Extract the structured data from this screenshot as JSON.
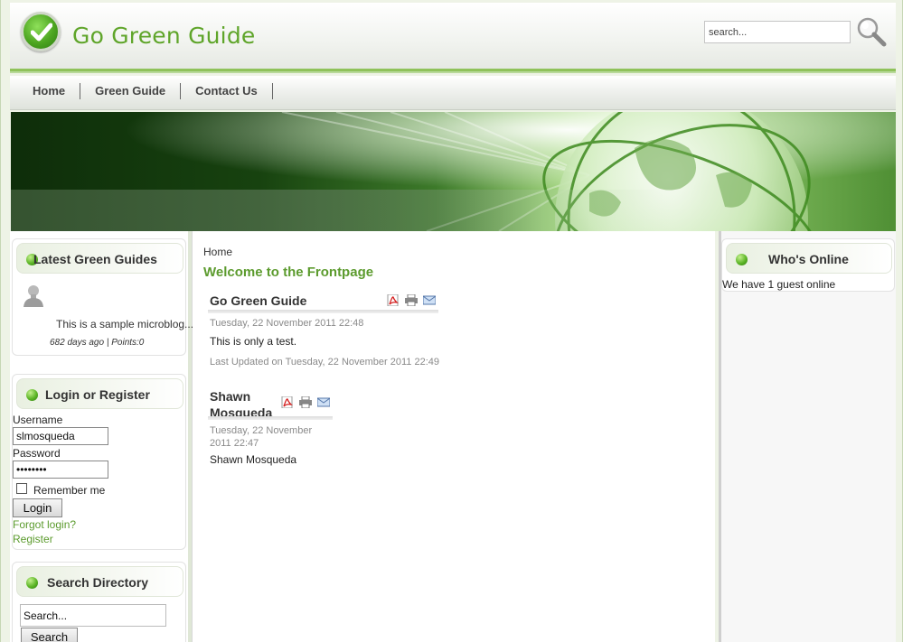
{
  "site": {
    "title": "Go Green Guide",
    "search_value": "search...",
    "accent": "#5fa52a"
  },
  "nav": {
    "items": [
      "Home",
      "Green Guide",
      "Contact Us"
    ]
  },
  "left": {
    "latest": {
      "title": "Latest Green Guides",
      "entry_text": "This is a sample microblog...",
      "meta_age": "682 days ago",
      "meta_points": "Points:0"
    },
    "login": {
      "title": "Login or Register",
      "username_label": "Username",
      "username_value": "slmosqueda",
      "password_label": "Password",
      "password_value": "********",
      "remember_label": "Remember me",
      "login_button": "Login",
      "forgot_link": "Forgot login?",
      "register_link": "Register"
    },
    "search_dir": {
      "title": "Search Directory",
      "input_value": "Search...",
      "button": "Search"
    }
  },
  "center": {
    "breadcrumb": "Home",
    "heading": "Welcome to the Frontpage",
    "articles": [
      {
        "title": "Go Green Guide",
        "date": "Tuesday, 22 November 2011 22:48",
        "body": "This is only a test.",
        "updated": "Last Updated on Tuesday, 22 November 2011 22:49"
      },
      {
        "title_line1": "Shawn",
        "title_line2": "Mosqueda",
        "date_line1": "Tuesday, 22 November",
        "date_line2": "2011 22:47",
        "body": "Shawn Mosqueda"
      }
    ]
  },
  "right": {
    "online": {
      "title": "Who's Online",
      "text": "We have 1 guest online"
    }
  }
}
